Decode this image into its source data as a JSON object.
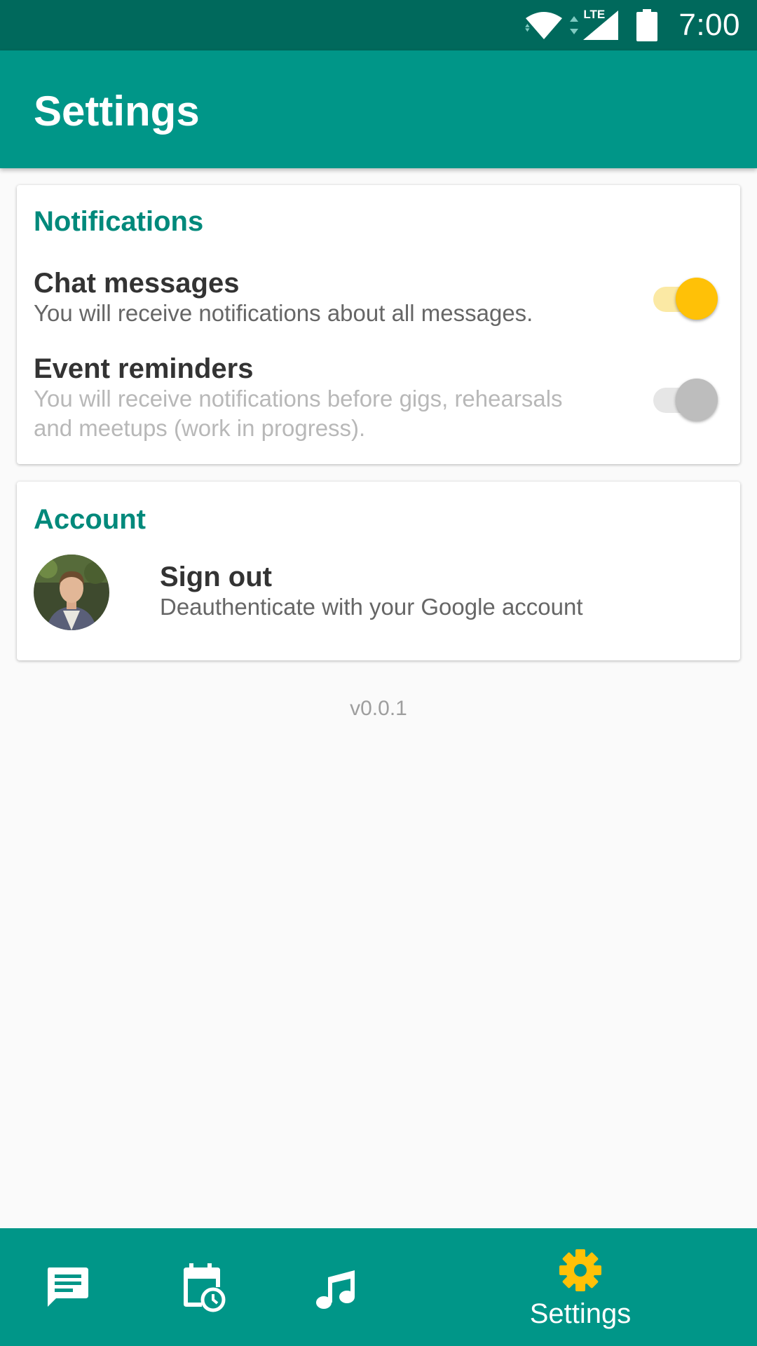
{
  "status_bar": {
    "time": "7:00",
    "network": "LTE",
    "icons": [
      "wifi-icon",
      "signal-icon",
      "battery-icon"
    ]
  },
  "app_bar": {
    "title": "Settings"
  },
  "notifications": {
    "section_title": "Notifications",
    "chat_messages": {
      "title": "Chat messages",
      "summary": "You will receive notifications about all messages.",
      "enabled": true
    },
    "event_reminders": {
      "title": "Event reminders",
      "summary_line1": "You will receive notifications before gigs, rehearsals",
      "summary_line2": "and meetups (work in progress).",
      "enabled": false
    }
  },
  "account": {
    "section_title": "Account",
    "sign_out": {
      "title": "Sign out",
      "summary": "Deauthenticate with your Google account"
    }
  },
  "version": "v0.0.1",
  "bottom_nav": {
    "items": [
      {
        "icon": "chat-icon",
        "label": ""
      },
      {
        "icon": "calendar-clock-icon",
        "label": ""
      },
      {
        "icon": "music-note-icon",
        "label": ""
      },
      {
        "icon": "gear-icon",
        "label": "Settings",
        "active": true
      }
    ]
  },
  "colors": {
    "primary": "#009688",
    "primary_dark": "#00695c",
    "accent": "#ffc107",
    "section_title": "#00897b"
  }
}
